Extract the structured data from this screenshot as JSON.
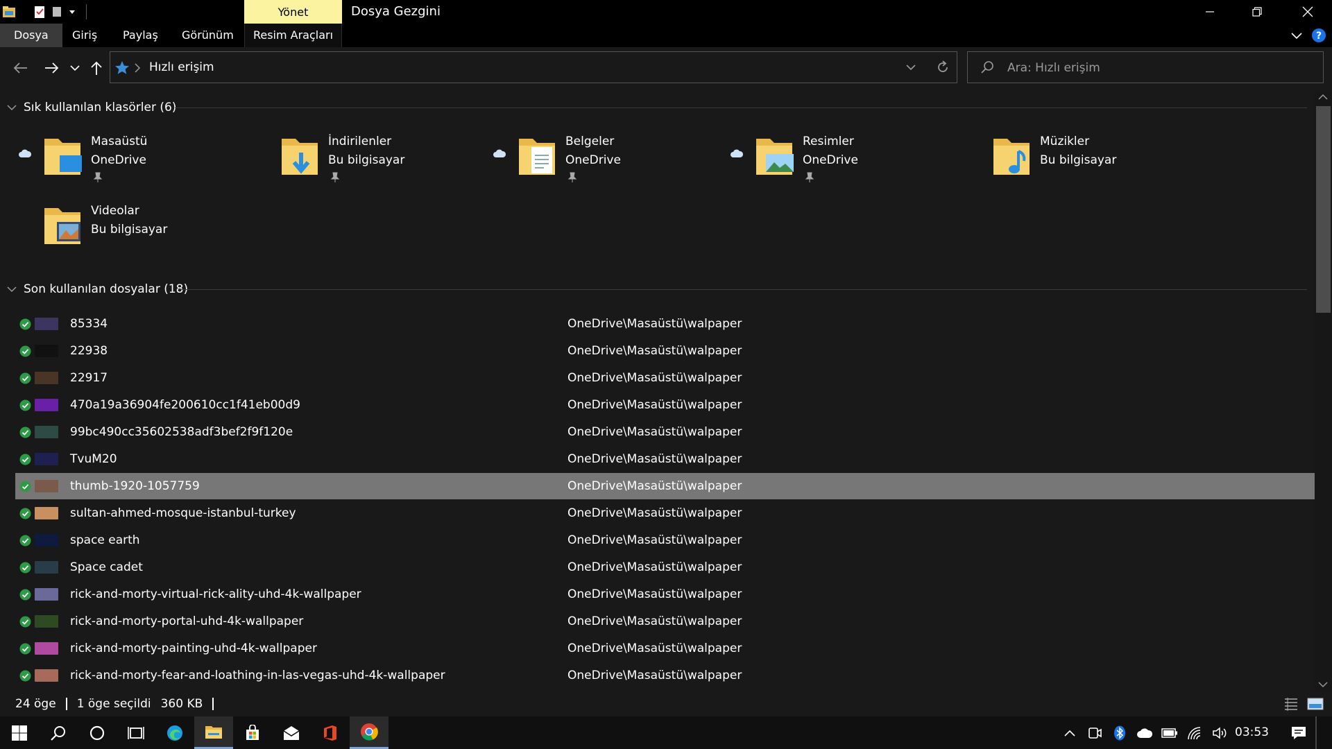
{
  "window": {
    "title": "Dosya Gezgini",
    "context_tab": "Yönet",
    "accent": "#fbf3a0"
  },
  "ribbon": {
    "tabs": [
      "Dosya",
      "Giriş",
      "Paylaş",
      "Görünüm",
      "Resim Araçları"
    ]
  },
  "nav": {
    "path_segment": "Hızlı erişim"
  },
  "search": {
    "placeholder": "Ara: Hızlı erişim"
  },
  "frequent": {
    "header": "Sık kullanılan klasörler (6)",
    "folders": [
      {
        "name": "Masaüstü",
        "location": "OneDrive",
        "pinned": true,
        "cloud": true,
        "icon": "desktop-folder-icon"
      },
      {
        "name": "İndirilenler",
        "location": "Bu bilgisayar",
        "pinned": true,
        "cloud": false,
        "icon": "downloads-folder-icon"
      },
      {
        "name": "Belgeler",
        "location": "OneDrive",
        "pinned": true,
        "cloud": true,
        "icon": "documents-folder-icon"
      },
      {
        "name": "Resimler",
        "location": "OneDrive",
        "pinned": true,
        "cloud": true,
        "icon": "pictures-folder-icon"
      },
      {
        "name": "Müzikler",
        "location": "Bu bilgisayar",
        "pinned": false,
        "cloud": false,
        "icon": "music-folder-icon"
      },
      {
        "name": "Videolar",
        "location": "Bu bilgisayar",
        "pinned": false,
        "cloud": false,
        "icon": "videos-folder-icon"
      }
    ]
  },
  "recent": {
    "header": "Son kullanılan dosyalar (18)",
    "files": [
      {
        "name": "85334",
        "location": "OneDrive\\Masaüstü\\walpaper",
        "thumb": "#3b3560"
      },
      {
        "name": "22938",
        "location": "OneDrive\\Masaüstü\\walpaper",
        "thumb": "#111111"
      },
      {
        "name": "22917",
        "location": "OneDrive\\Masaüstü\\walpaper",
        "thumb": "#4a3426"
      },
      {
        "name": "470a19a36904fe200610cc1f41eb00d9",
        "location": "OneDrive\\Masaüstü\\walpaper",
        "thumb": "#6a1fa8"
      },
      {
        "name": "99bc490cc35602538adf3bef2f9f120e",
        "location": "OneDrive\\Masaüstü\\walpaper",
        "thumb": "#2e4a45"
      },
      {
        "name": "TvuM20",
        "location": "OneDrive\\Masaüstü\\walpaper",
        "thumb": "#1d2050"
      },
      {
        "name": "thumb-1920-1057759",
        "location": "OneDrive\\Masaüstü\\walpaper",
        "thumb": "#7a5a4a",
        "selected": true
      },
      {
        "name": "sultan-ahmed-mosque-istanbul-turkey",
        "location": "OneDrive\\Masaüstü\\walpaper",
        "thumb": "#c89060"
      },
      {
        "name": "space earth",
        "location": "OneDrive\\Masaüstü\\walpaper",
        "thumb": "#0e1a3e"
      },
      {
        "name": "Space cadet",
        "location": "OneDrive\\Masaüstü\\walpaper",
        "thumb": "#283c4a"
      },
      {
        "name": "rick-and-morty-virtual-rick-ality-uhd-4k-wallpaper",
        "location": "OneDrive\\Masaüstü\\walpaper",
        "thumb": "#6a6a9a"
      },
      {
        "name": "rick-and-morty-portal-uhd-4k-wallpaper",
        "location": "OneDrive\\Masaüstü\\walpaper",
        "thumb": "#2e4a22"
      },
      {
        "name": "rick-and-morty-painting-uhd-4k-wallpaper",
        "location": "OneDrive\\Masaüstü\\walpaper",
        "thumb": "#b04aa0"
      },
      {
        "name": "rick-and-morty-fear-and-loathing-in-las-vegas-uhd-4k-wallpaper",
        "location": "OneDrive\\Masaüstü\\walpaper",
        "thumb": "#a86a5a"
      }
    ]
  },
  "status": {
    "count": "24 öge",
    "selection": "1 öge seçildi",
    "size": "360 KB"
  },
  "taskbar": {
    "clock": "03:53",
    "accent": "#77a3d8"
  }
}
